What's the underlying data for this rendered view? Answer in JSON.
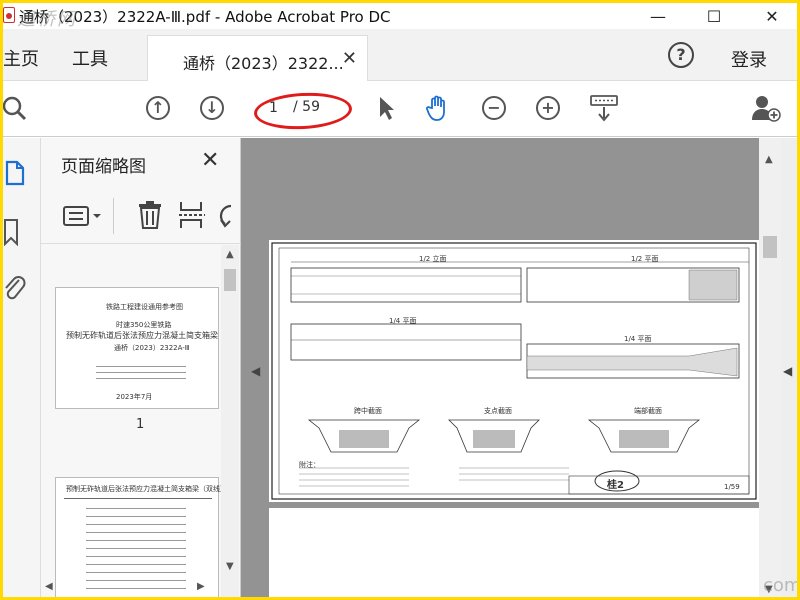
{
  "window": {
    "title": "通桥（2023）2322A-Ⅲ.pdf - Adobe Acrobat Pro DC",
    "watermark_text": "迅桥网",
    "minimize": "—",
    "maximize": "☐",
    "close": "✕"
  },
  "tabs": {
    "home": "主页",
    "tools": "工具",
    "document": "通桥（2023）2322...",
    "help": "?",
    "login": "登录"
  },
  "toolbar": {
    "current_page": "1",
    "total_pages": "/ 59"
  },
  "thumbnails_panel": {
    "title": "页面缩略图",
    "close": "✕",
    "page1_label": "1",
    "page1_texts": {
      "series": "铁路工程建设通用参考图",
      "project": "时速350公里铁路",
      "title": "预制无砟轨道后张法预应力混凝土简支箱梁（双线）",
      "code": "通桥（2023）2322A-Ⅲ",
      "date": "2023年7月"
    },
    "page2_texts": {
      "title": "预制无砟轨道后张法预应力混凝土简支箱梁（双线）"
    }
  },
  "document": {
    "stamp_text": "桂2",
    "sheet_number": "1/59",
    "drawing_labels": [
      "1/2 立面",
      "1/2 平面",
      "1/4 平面",
      "1/4 平面",
      "跨中截面",
      "支点截面",
      "端部截面",
      "附注："
    ]
  },
  "watermark_bottom": "com",
  "colors": {
    "accent_blue": "#1f6fd1",
    "annotation_red": "#e01b1b",
    "frame_yellow": "#ffd900"
  }
}
